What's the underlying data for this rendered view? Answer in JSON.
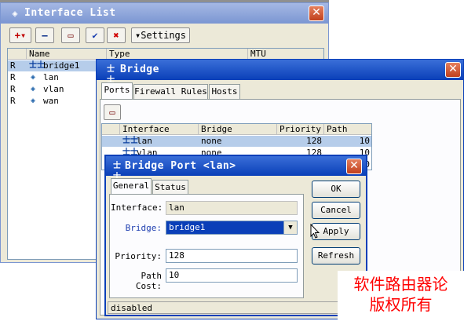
{
  "interface_list": {
    "title": "Interface List",
    "toolbar": {
      "add_label": "+▾",
      "remove_label": "—",
      "comment_label": "▭",
      "enable_label": "✔",
      "disable_label": "✖",
      "settings_label": "▾Settings"
    },
    "columns": {
      "flag": "",
      "name": "Name",
      "type": "Type",
      "mtu": "MTU"
    },
    "rows": [
      {
        "flag": "R",
        "name": "bridge1"
      },
      {
        "flag": "R",
        "name": "lan"
      },
      {
        "flag": "R",
        "name": "vlan"
      },
      {
        "flag": "R",
        "name": "wan"
      }
    ]
  },
  "bridge": {
    "title": "Bridge",
    "tabs": [
      "Ports",
      "Firewall Rules",
      "Hosts"
    ],
    "columns": {
      "interface": "Interface",
      "bridge": "Bridge",
      "priority": "Priority",
      "path_cost": "Path Cost"
    },
    "rows": [
      {
        "interface": "lan",
        "bridge": "none",
        "priority": "128",
        "path_cost": "10"
      },
      {
        "interface": "vlan",
        "bridge": "none",
        "priority": "128",
        "path_cost": "10"
      },
      {
        "interface": "",
        "bridge": "",
        "priority": "",
        "path_cost": "10"
      }
    ]
  },
  "bridge_port": {
    "title": "Bridge Port <lan>",
    "tabs": [
      "General",
      "Status"
    ],
    "interface_label": "Interface:",
    "interface_value": "lan",
    "bridge_label": "Bridge:",
    "bridge_value": "bridge1",
    "priority_label": "Priority:",
    "priority_value": "128",
    "path_cost_label": "Path Cost:",
    "path_cost_value": "10",
    "status": "disabled",
    "buttons": {
      "ok": "OK",
      "cancel": "Cancel",
      "apply": "Apply",
      "comment_out": "Refresh"
    }
  },
  "watermark": {
    "line1": "软件路由器论",
    "line2": "版权所有"
  },
  "colors": {
    "title_active": "#0a3fb8",
    "title_inactive": "#7b96d2",
    "selection": "#b6cdea",
    "close": "#c1401c",
    "watermark": "#ff0000"
  },
  "icons": [
    "interface-icon",
    "bridge-icon",
    "close-icon",
    "cursor-icon",
    "dropdown-arrow-icon"
  ]
}
